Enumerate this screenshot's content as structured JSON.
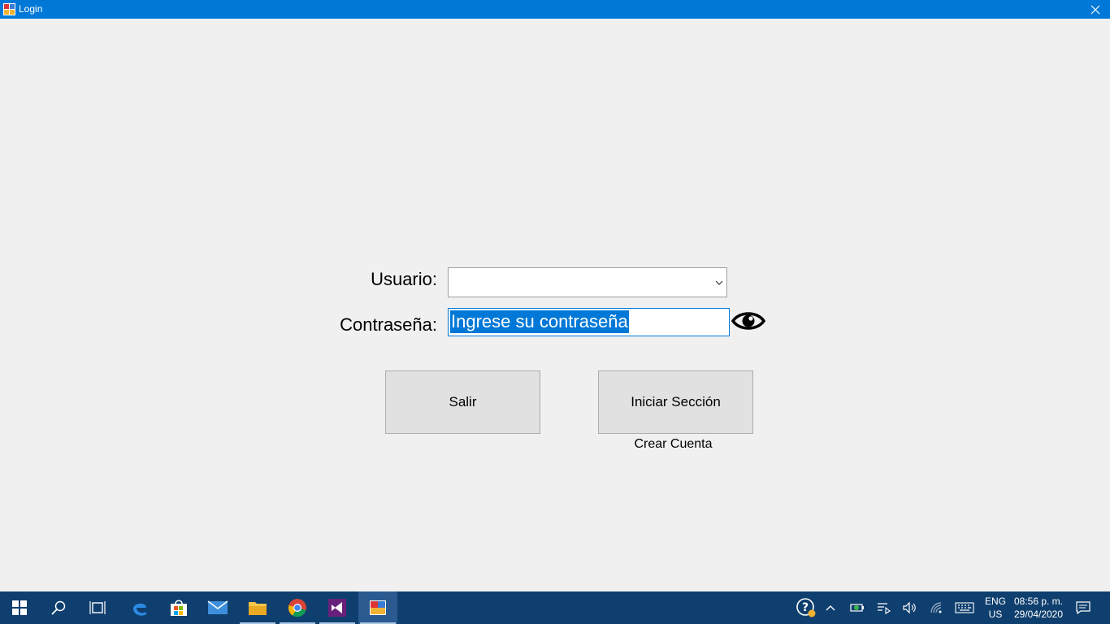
{
  "window": {
    "title": "Login",
    "close_icon": "close-icon"
  },
  "form": {
    "user_label": "Usuario:",
    "user_value": "",
    "password_label": "Contraseña:",
    "password_value": "Ingrese su contraseña",
    "show_password_icon": "eye-icon",
    "exit_button": "Salir",
    "login_button": "Iniciar Sección",
    "create_account_link": "Crear Cuenta"
  },
  "taskbar": {
    "items": [
      "start-icon",
      "search-icon",
      "task-view-icon",
      "edge-icon",
      "store-icon",
      "mail-icon",
      "file-explorer-icon",
      "chrome-icon",
      "visual-studio-icon",
      "login-app-icon"
    ],
    "tray_icons": [
      "help-icon",
      "chevron-up-icon",
      "battery-icon",
      "network-settings-icon",
      "volume-icon",
      "wifi-icon",
      "keyboard-icon"
    ],
    "lang_line1": "ENG",
    "lang_line2": "US",
    "time": "08:56 p. m.",
    "date": "29/04/2020",
    "notifications_icon": "notifications-icon"
  },
  "colors": {
    "titlebar": "#0078d7",
    "background": "#f0f0f0",
    "taskbar": "#0f3f6e",
    "selection": "#0078d7"
  }
}
